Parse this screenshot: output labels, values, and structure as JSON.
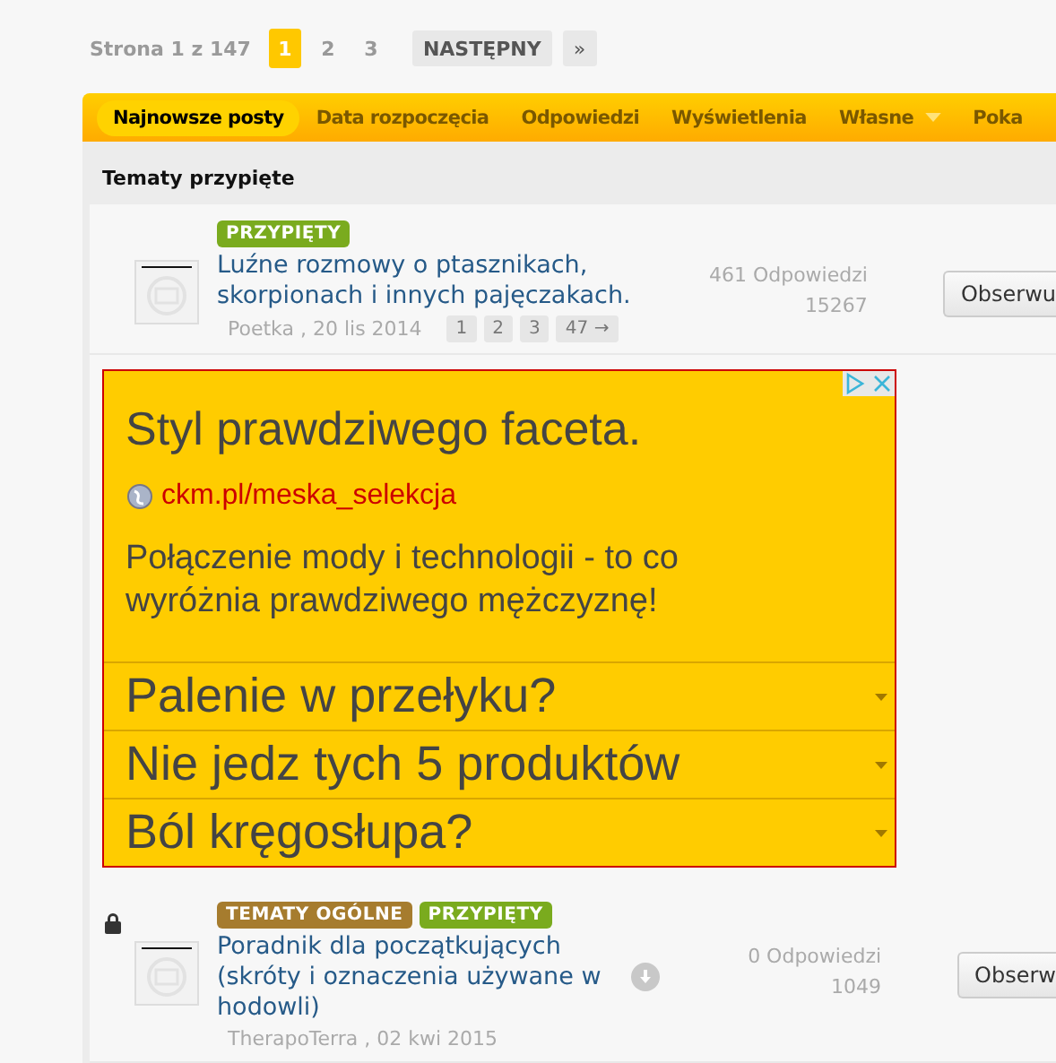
{
  "pagination": {
    "label": "Strona 1 z 147",
    "pages": [
      {
        "label": "1",
        "selected": true
      },
      {
        "label": "2",
        "selected": false
      },
      {
        "label": "3",
        "selected": false
      }
    ],
    "next": "NASTĘPNY",
    "last": "»"
  },
  "nav": [
    {
      "label": "Najnowsze posty",
      "selected": true,
      "dropdown": false
    },
    {
      "label": "Data rozpoczęcia",
      "selected": false,
      "dropdown": false
    },
    {
      "label": "Odpowiedzi",
      "selected": false,
      "dropdown": false
    },
    {
      "label": "Wyświetlenia",
      "selected": false,
      "dropdown": false
    },
    {
      "label": "Własne",
      "selected": false,
      "dropdown": true
    },
    {
      "label": "Poka",
      "selected": false,
      "dropdown": false
    }
  ],
  "section_title": "Tematy przypięte",
  "items": [
    {
      "kind": "topic",
      "locked": false,
      "preview": false,
      "tags": [
        {
          "label": "PRZYPIĘTY",
          "color": "#7aab1e"
        }
      ],
      "title": "Luźne rozmowy o ptasznikach, skorpionach i innych pajęczakach.",
      "author_date": "Poetka , 20 lis 2014",
      "pages": [
        "1",
        "2",
        "3",
        "47 →"
      ],
      "replies": "461 Odpowiedzi",
      "views": "15267",
      "button": "Obserwu"
    },
    {
      "kind": "ad",
      "headline": "Styl prawdziwego faceta.",
      "url": "ckm.pl/meska_selekcja",
      "description": "Połączenie mody i technologii - to co wyróżnia prawdziwego mężczyznę!",
      "links": [
        "Palenie w przełyku?",
        "Nie jedz tych 5 produktów",
        "Ból kręgosłupa?"
      ]
    },
    {
      "kind": "topic",
      "locked": true,
      "preview": true,
      "tags": [
        {
          "label": "TEMATY OGÓLNE",
          "color": "#a67c2e"
        },
        {
          "label": "PRZYPIĘTY",
          "color": "#7aab1e"
        }
      ],
      "title": "Poradnik dla początkujących (skróty i oznaczenia używane w hodowli)",
      "author_date": "TherapoTerra , 02 kwi 2015",
      "replies": "0 Odpowiedzi",
      "views": "1049",
      "button": "Obserw"
    }
  ]
}
